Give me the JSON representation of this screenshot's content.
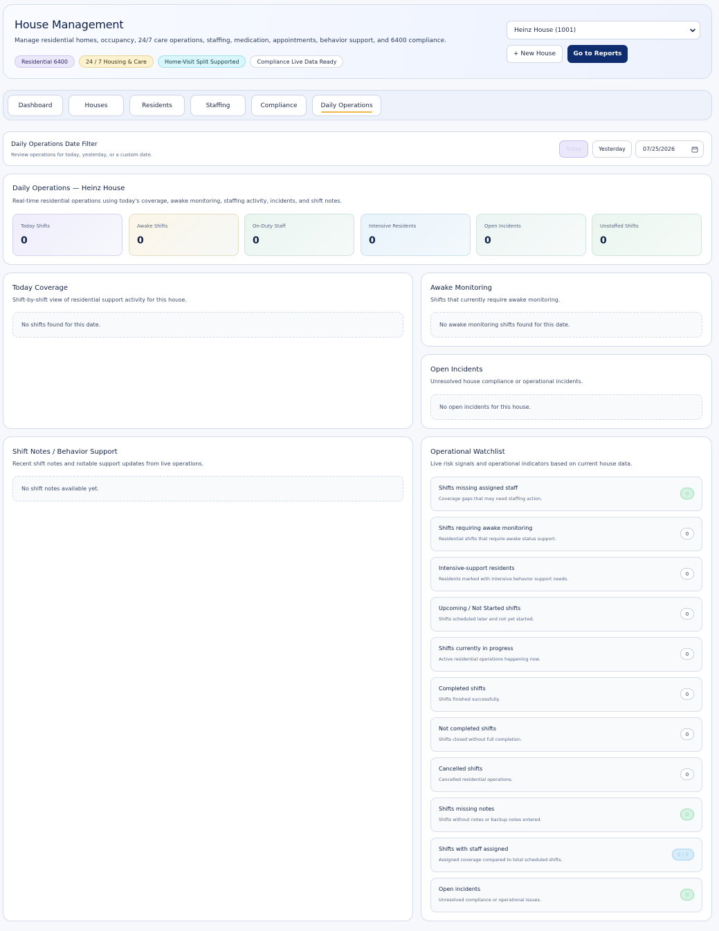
{
  "header": {
    "title": "House Management",
    "subtitle": "Manage residential homes, occupancy, 24/7 care operations, staffing, medication, appointments, behavior support, and 6400 compliance.",
    "chips": [
      "Residential 6400",
      "24 / 7 Housing & Care",
      "Home-Visit Split Supported",
      "Compliance Live Data Ready"
    ],
    "house_select": "Heinz House (1001)",
    "new_house_label": "+ New House",
    "reports_label": "Go to Reports"
  },
  "tabs": [
    "Dashboard",
    "Houses",
    "Residents",
    "Staffing",
    "Compliance",
    "Daily Operations"
  ],
  "date_filter": {
    "title": "Daily Operations Date Filter",
    "subtitle": "Review operations for today, yesterday, or a custom date.",
    "today_label": "Today",
    "yesterday_label": "Yesterday",
    "date_value": "07/25/2026"
  },
  "daily_ops": {
    "title": "Daily Operations — Heinz House",
    "subtitle": "Real-time residential operations using today's coverage, awake monitoring, staffing activity, incidents, and shift notes.",
    "stats": [
      {
        "label": "Today Shifts",
        "value": "0"
      },
      {
        "label": "Awake Shifts",
        "value": "0"
      },
      {
        "label": "On-Duty Staff",
        "value": "0"
      },
      {
        "label": "Intensive Residents",
        "value": "0"
      },
      {
        "label": "Open Incidents",
        "value": "0"
      },
      {
        "label": "Unstaffed Shifts",
        "value": "0"
      }
    ]
  },
  "coverage": {
    "title": "Today Coverage",
    "subtitle": "Shift-by-shift view of residential support activity for this house.",
    "empty": "No shifts found for this date."
  },
  "awake": {
    "title": "Awake Monitoring",
    "subtitle": "Shifts that currently require awake monitoring.",
    "empty": "No awake monitoring shifts found for this date."
  },
  "incidents": {
    "title": "Open Incidents",
    "subtitle": "Unresolved house compliance or operational incidents.",
    "empty": "No open incidents for this house."
  },
  "notes": {
    "title": "Shift Notes / Behavior Support",
    "subtitle": "Recent shift notes and notable support updates from live operations.",
    "empty": "No shift notes available yet."
  },
  "watchlist": {
    "title": "Operational Watchlist",
    "subtitle": "Live risk signals and operational indicators based on current house data.",
    "items": [
      {
        "title": "Shifts missing assigned staff",
        "desc": "Coverage gaps that may need staffing action.",
        "badge": "0",
        "tone": "green"
      },
      {
        "title": "Shifts requiring awake monitoring",
        "desc": "Residential shifts that require awake status support.",
        "badge": "0",
        "tone": "neutral"
      },
      {
        "title": "Intensive-support residents",
        "desc": "Residents marked with intensive behavior support needs.",
        "badge": "0",
        "tone": "neutral"
      },
      {
        "title": "Upcoming / Not Started shifts",
        "desc": "Shifts scheduled later and not yet started.",
        "badge": "0",
        "tone": "neutral"
      },
      {
        "title": "Shifts currently in progress",
        "desc": "Active residential operations happening now.",
        "badge": "0",
        "tone": "neutral"
      },
      {
        "title": "Completed shifts",
        "desc": "Shifts finished successfully.",
        "badge": "0",
        "tone": "neutral"
      },
      {
        "title": "Not completed shifts",
        "desc": "Shifts closed without full completion.",
        "badge": "0",
        "tone": "neutral"
      },
      {
        "title": "Cancelled shifts",
        "desc": "Cancelled residential operations.",
        "badge": "0",
        "tone": "neutral"
      },
      {
        "title": "Shifts missing notes",
        "desc": "Shifts without notes or backup notes entered.",
        "badge": "0",
        "tone": "green"
      },
      {
        "title": "Shifts with staff assigned",
        "desc": "Assigned coverage compared to total scheduled shifts.",
        "badge": "0 / 0",
        "tone": "blue"
      },
      {
        "title": "Open incidents",
        "desc": "Unresolved compliance or operational issues.",
        "badge": "0",
        "tone": "green"
      }
    ]
  },
  "colors": {
    "primary": "#0f2d6e",
    "tab_indicator": "#f0b64a",
    "page_bg": "#f6f8fc"
  }
}
